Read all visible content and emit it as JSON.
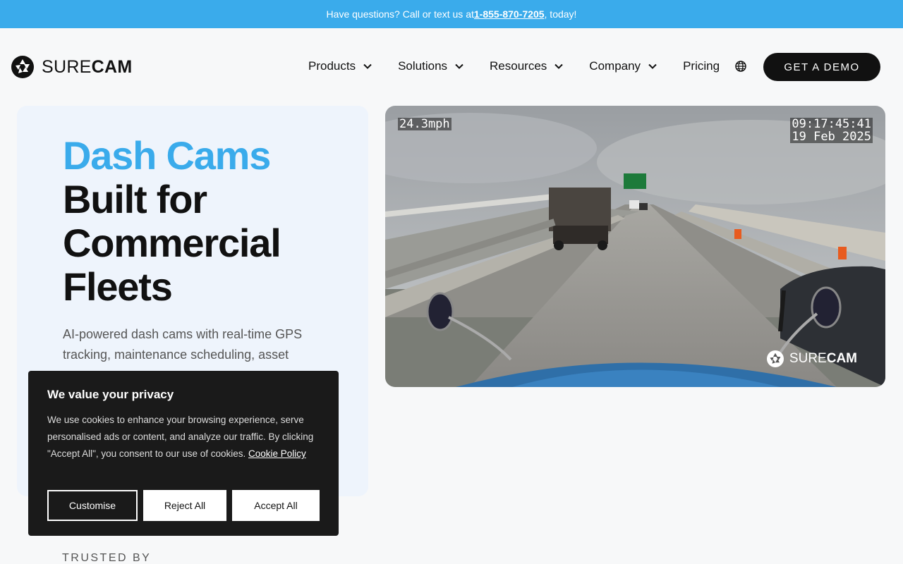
{
  "topbar": {
    "prefix": "Have questions? Call or text us at ",
    "phone": "1-855-870-7205",
    "suffix": ", today!"
  },
  "logo": {
    "part1": "SURE",
    "part2": "CAM",
    "icon": "shutter-icon"
  },
  "nav": {
    "items": [
      {
        "label": "Products"
      },
      {
        "label": "Solutions"
      },
      {
        "label": "Resources"
      },
      {
        "label": "Company"
      }
    ],
    "pricing": "Pricing",
    "globe_icon": "globe-icon",
    "demo_label": "GET A DEMO"
  },
  "hero": {
    "accent": "Dash Cams",
    "line1": "Built for",
    "line2": "Commercial",
    "line3": "Fleets",
    "desc": "AI-powered dash cams with real-time GPS tracking, maintenance scheduling, asset"
  },
  "video": {
    "speed": "24.3mph",
    "time": "09:17:45:41",
    "date": "19 Feb 2025",
    "watermark_part1": "SURE",
    "watermark_part2": "CAM"
  },
  "cookie": {
    "title": "We value your privacy",
    "body": "We use cookies to enhance your browsing experience, serve personalised ads or content, and analyze our traffic. By clicking \"Accept All\", you consent to our use of cookies. ",
    "link": "Cookie Policy",
    "customise": "Customise",
    "reject": "Reject All",
    "accept": "Accept All"
  },
  "trusted": "TRUSTED BY",
  "colors": {
    "accent": "#3aabeb",
    "dark": "#111111",
    "card": "#eef4fc"
  }
}
